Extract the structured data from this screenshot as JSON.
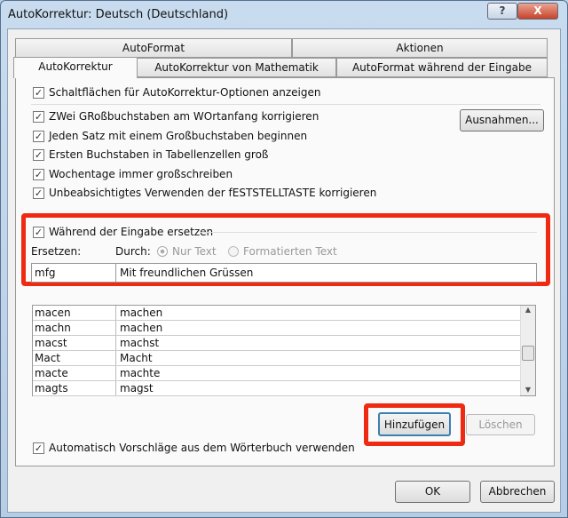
{
  "window": {
    "title": "AutoKorrektur: Deutsch (Deutschland)",
    "help": "?",
    "close": "X"
  },
  "tabs_back": [
    "AutoFormat",
    "Aktionen"
  ],
  "tabs_front": [
    "AutoKorrektur",
    "AutoKorrektur von Mathematik",
    "AutoFormat während der Eingabe"
  ],
  "options": {
    "show_buttons": "Schaltflächen für AutoKorrektur-Optionen anzeigen",
    "two_caps": "ZWei GRoßbuchstaben am WOrtanfang korrigieren",
    "sentence": "Jeden Satz mit einem Großbuchstaben beginnen",
    "table_cells": "Ersten Buchstaben in Tabellenzellen groß",
    "weekdays": "Wochentage immer großschreiben",
    "capslock": "Unbeabsichtigtes Verwenden der fESTSTELLTASTE korrigieren",
    "exceptions": "Ausnahmen..."
  },
  "replace": {
    "checkbox": "Während der Eingabe ersetzen",
    "replace_label": "Ersetzen:",
    "with_label": "Durch:",
    "plain": "Nur Text",
    "formatted": "Formatierten Text",
    "replace_value": "mfg",
    "with_value": "Mit freundlichen Grüssen"
  },
  "list": [
    [
      "macen",
      "machen"
    ],
    [
      "machn",
      "machen"
    ],
    [
      "macst",
      "machst"
    ],
    [
      "Mact",
      "Macht"
    ],
    [
      "macte",
      "machte"
    ],
    [
      "magts",
      "magst"
    ]
  ],
  "buttons": {
    "add": "Hinzufügen",
    "delete": "Löschen",
    "ok": "OK",
    "cancel": "Abbrechen"
  },
  "suggest": "Automatisch Vorschläge aus dem Wörterbuch verwenden",
  "colors": {
    "highlight": "#ee2a13"
  }
}
